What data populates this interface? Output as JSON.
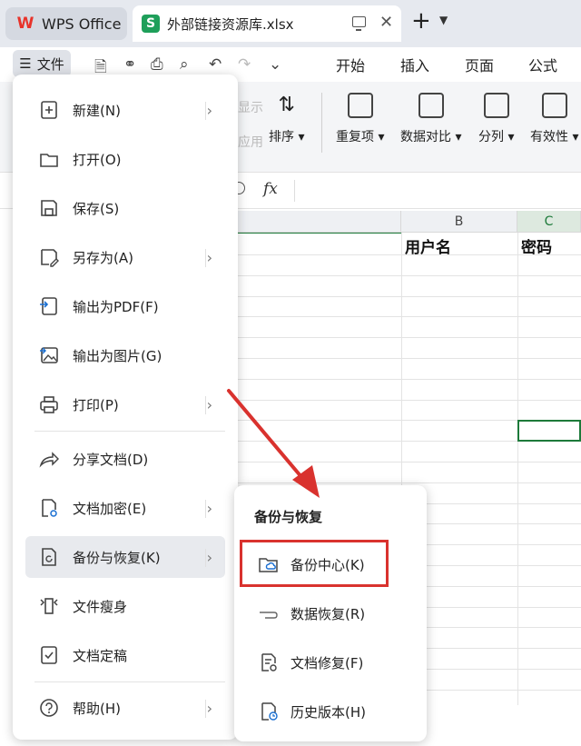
{
  "titlebar": {
    "home_tab": "WPS Office",
    "doc_tab": "外部链接资源库.xlsx",
    "doc_badge": "S",
    "close_glyph": "✕",
    "new_tab_glyph": "+"
  },
  "menu_row": {
    "file_label": "文件",
    "tabs": [
      "开始",
      "插入",
      "页面",
      "公式"
    ]
  },
  "toolbar": {
    "faded_1": "显示",
    "faded_2": "应用",
    "sort": "排序",
    "duplicate": "重复项",
    "compare": "数据对比",
    "split": "分列",
    "validity": "有效性"
  },
  "formula": {
    "fx": "fx"
  },
  "grid": {
    "col_b": "B",
    "col_c": "C",
    "cell_b1": "用户名",
    "cell_c1": "密码"
  },
  "file_menu": {
    "items": [
      {
        "label": "新建(N)",
        "icon": "new-file-icon",
        "submenu": true
      },
      {
        "label": "打开(O)",
        "icon": "folder-icon",
        "submenu": false
      },
      {
        "label": "保存(S)",
        "icon": "save-icon",
        "submenu": false
      },
      {
        "label": "另存为(A)",
        "icon": "save-as-icon",
        "submenu": true
      },
      {
        "label": "输出为PDF(F)",
        "icon": "export-pdf-icon",
        "submenu": false
      },
      {
        "label": "输出为图片(G)",
        "icon": "export-image-icon",
        "submenu": false
      },
      {
        "label": "打印(P)",
        "icon": "printer-icon",
        "submenu": true
      },
      {
        "label": "分享文档(D)",
        "icon": "share-icon",
        "submenu": false
      },
      {
        "label": "文档加密(E)",
        "icon": "lock-doc-icon",
        "submenu": true
      },
      {
        "label": "备份与恢复(K)",
        "icon": "backup-icon",
        "submenu": true
      },
      {
        "label": "文件瘦身",
        "icon": "slim-file-icon",
        "submenu": false
      },
      {
        "label": "文档定稿",
        "icon": "finalize-icon",
        "submenu": false
      },
      {
        "label": "帮助(H)",
        "icon": "help-icon",
        "submenu": true
      }
    ]
  },
  "submenu": {
    "title": "备份与恢复",
    "items": [
      {
        "label": "备份中心(K)",
        "icon": "cloud-folder-icon"
      },
      {
        "label": "数据恢复(R)",
        "icon": "data-recovery-icon"
      },
      {
        "label": "文档修复(F)",
        "icon": "doc-repair-icon"
      },
      {
        "label": "历史版本(H)",
        "icon": "history-icon"
      }
    ]
  },
  "colors": {
    "accent_green": "#1d7a3a",
    "highlight_red": "#d9322e",
    "wps_red": "#e8332a"
  }
}
